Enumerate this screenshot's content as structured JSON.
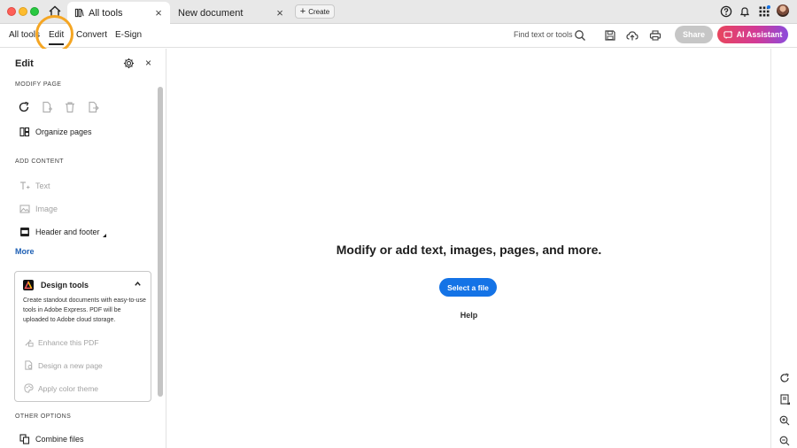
{
  "tabs": [
    {
      "label": "All tools",
      "close": "×"
    },
    {
      "label": "New document",
      "close": "×"
    }
  ],
  "create_label": "Create",
  "toolbar": {
    "menu": [
      "All tools",
      "Edit",
      "Convert",
      "E-Sign"
    ],
    "active": "Edit",
    "search_label": "Find text or tools",
    "share_label": "Share",
    "ai_label": "AI Assistant"
  },
  "panel": {
    "title": "Edit",
    "close": "×",
    "modify_section": "MODIFY PAGE",
    "organize_label": "Organize pages",
    "add_section": "ADD CONTENT",
    "text_label": "Text",
    "image_label": "Image",
    "header_footer_label": "Header and footer",
    "more_label": "More",
    "design_tools": {
      "title": "Design tools",
      "description": "Create standout documents with easy-to-use tools in Adobe Express. PDF will be uploaded to Adobe cloud storage.",
      "enhance": "Enhance this PDF",
      "design_page": "Design a new page",
      "color_theme": "Apply color theme"
    },
    "other_section": "OTHER OPTIONS",
    "combine_label": "Combine files"
  },
  "main": {
    "heading": "Modify or add text, images, pages, and more.",
    "select_button": "Select a file",
    "help": "Help"
  },
  "colors": {
    "primary_blue": "#1473e6",
    "highlight_ring": "#f5a623",
    "ai_gradient_start": "#e8455d",
    "ai_gradient_end": "#8b4bdc"
  }
}
